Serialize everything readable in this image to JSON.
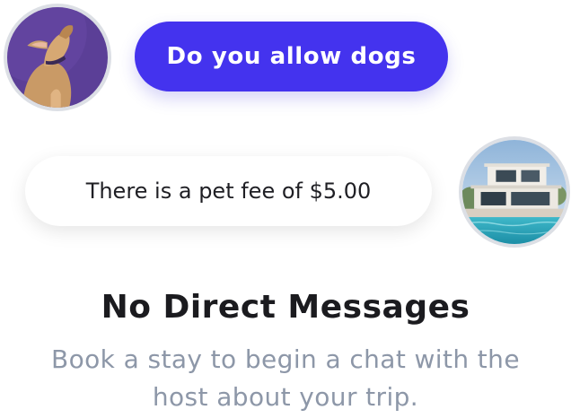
{
  "conversation": {
    "messages": [
      {
        "sender": "guest",
        "text": "Do you allow dogs",
        "avatar_icon": "dog-avatar"
      },
      {
        "sender": "host",
        "text": "There is a pet fee of $5.00",
        "avatar_icon": "house-avatar"
      }
    ]
  },
  "empty_state": {
    "title": "No Direct Messages",
    "subtitle_line1": "Book a stay to begin a chat with the",
    "subtitle_line2": "host about your trip."
  },
  "colors": {
    "accent": "#4433ee",
    "subtitle": "#8d97a8",
    "title": "#1b1b1f",
    "avatar_border": "#dcdfe5"
  }
}
